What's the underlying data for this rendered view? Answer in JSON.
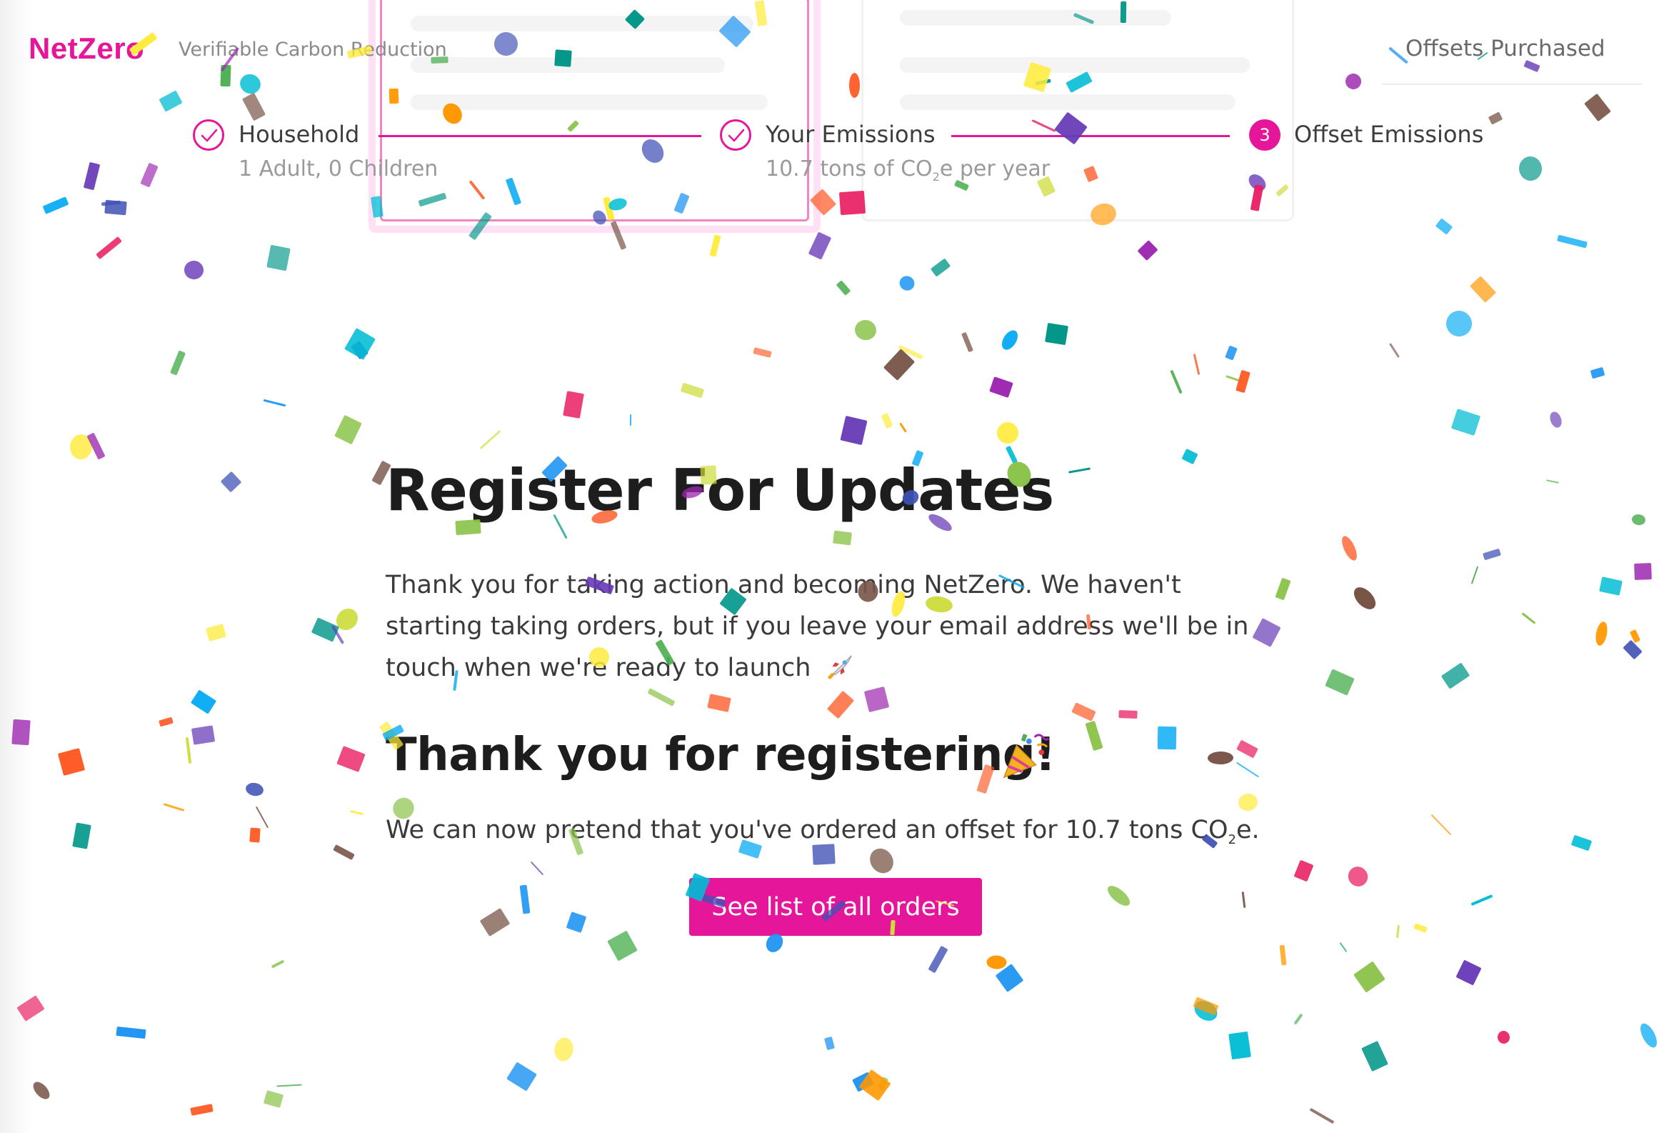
{
  "brand": {
    "logo": "NetZero",
    "tagline": "Verifiable Carbon Reduction",
    "accent_color": "#e6169b"
  },
  "nav": {
    "offsets_link": "Offsets Purchased"
  },
  "stepper": {
    "steps": [
      {
        "title": "Household",
        "subtitle": "1 Adult, 0 Children",
        "status": "complete",
        "icon": "check-icon"
      },
      {
        "title": "Your Emissions",
        "subtitle_pre": "10.7 tons of CO",
        "subtitle_sub": "2",
        "subtitle_post": "e per year",
        "status": "complete",
        "icon": "check-icon"
      },
      {
        "title": "Offset Emissions",
        "number": "3",
        "status": "active"
      }
    ]
  },
  "main": {
    "heading": "Register For Updates",
    "intro": "Thank you for taking action and becoming NetZero. We haven't starting taking orders, but if you leave your email address we'll be in touch when we're ready to launch",
    "rocket_icon": "rocket-emoji",
    "thanks_heading": "Thank you for registering!",
    "party_icon": "party-popper-emoji",
    "confirm_pre": "We can now pretend that you've ordered an offset for 10.7 tons CO",
    "confirm_sub": "2",
    "confirm_post": "e.",
    "button_label": "See list of all orders"
  },
  "confetti_colors": [
    "#e91e63",
    "#ff5722",
    "#ff9800",
    "#ffeb3b",
    "#cddc39",
    "#8bc34a",
    "#4caf50",
    "#009688",
    "#00bcd4",
    "#03a9f4",
    "#2196f3",
    "#3f51b5",
    "#673ab7",
    "#9c27b0",
    "#795548"
  ]
}
